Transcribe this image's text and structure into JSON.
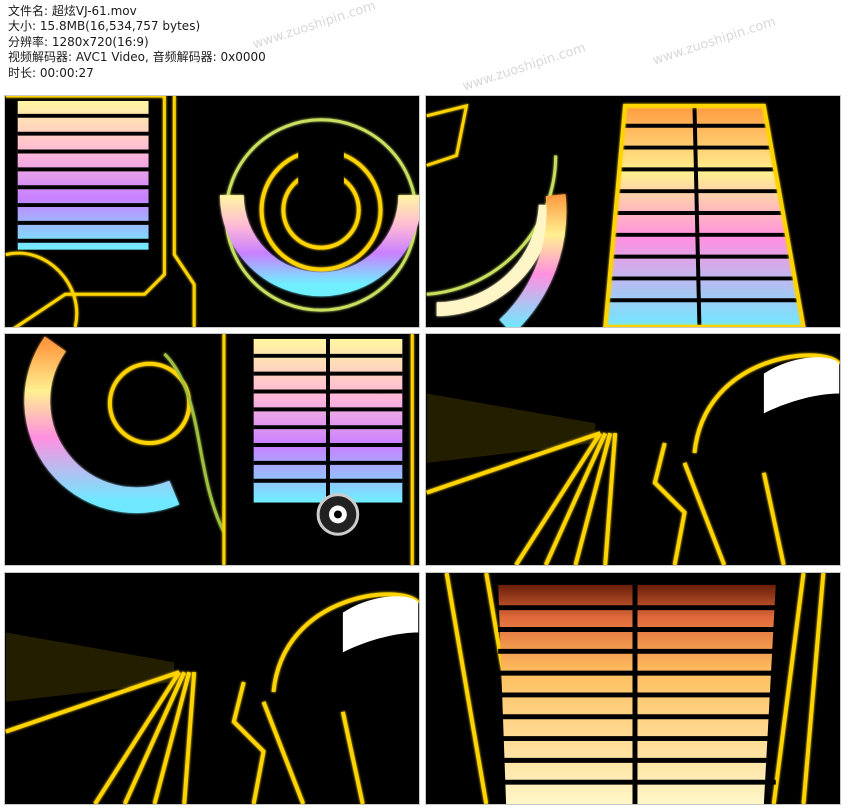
{
  "info": {
    "filename_label": "文件名:",
    "filename": "超炫VJ-61.mov",
    "size_label": "大小:",
    "size": "15.8MB(16,534,757 bytes)",
    "resolution_label": "分辨率:",
    "resolution": "1280x720(16:9)",
    "codec_label": "视频解码器:",
    "codec": "AVC1 Video, 音频解码器: 0x0000",
    "duration_label": "时长:",
    "duration": "00:00:27"
  },
  "watermark": "www.zuoshipin.com",
  "colors": {
    "neon_yellow": "#ffd400",
    "bg": "#000000"
  }
}
